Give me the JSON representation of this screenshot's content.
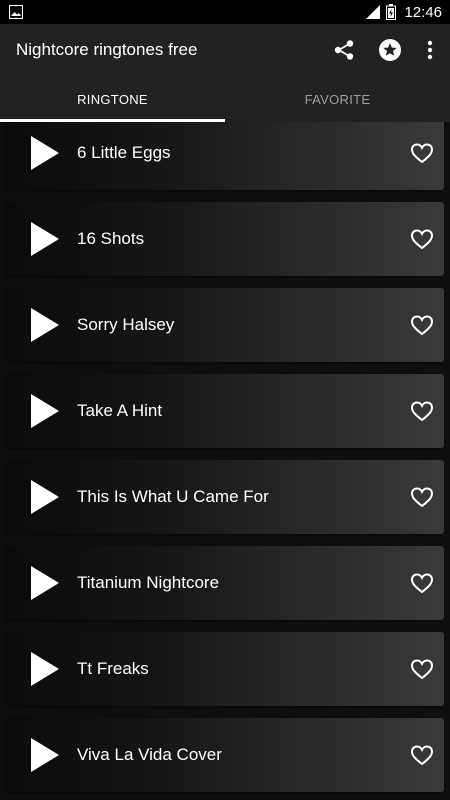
{
  "status_bar": {
    "time": "12:46",
    "icons": [
      "image-icon",
      "signal-icon",
      "battery-icon"
    ]
  },
  "app_bar": {
    "title": "Nightcore ringtones free",
    "actions": [
      "share-icon",
      "star-icon",
      "more-vert-icon"
    ]
  },
  "tabs": [
    {
      "label": "RINGTONE",
      "selected": true
    },
    {
      "label": "FAVORITE",
      "selected": false
    }
  ],
  "ringtones": [
    {
      "title": "6 Little Eggs"
    },
    {
      "title": "16 Shots"
    },
    {
      "title": "Sorry Halsey"
    },
    {
      "title": "Take A Hint"
    },
    {
      "title": "This Is What U Came For"
    },
    {
      "title": "Titanium Nightcore"
    },
    {
      "title": "Tt Freaks"
    },
    {
      "title": "Viva La Vida Cover"
    }
  ],
  "colors": {
    "app_bar": "#222222",
    "status_bar": "#000000",
    "tab_active": "#ffffff",
    "tab_inactive": "#9e9e9e",
    "background": "#0f0f0f"
  }
}
